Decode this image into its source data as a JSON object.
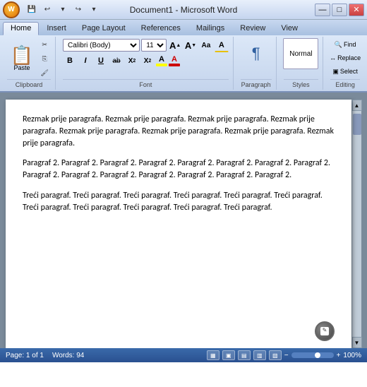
{
  "titlebar": {
    "title": "Document1 - Microsoft Word",
    "min_btn": "—",
    "max_btn": "□",
    "close_btn": "✕"
  },
  "quicktoolbar": {
    "save_icon": "💾",
    "undo_icon": "↩",
    "redo_icon": "↪"
  },
  "ribbon": {
    "tabs": [
      {
        "label": "Home",
        "active": true
      },
      {
        "label": "Insert",
        "active": false
      },
      {
        "label": "Page Layout",
        "active": false
      },
      {
        "label": "References",
        "active": false
      },
      {
        "label": "Mailings",
        "active": false
      },
      {
        "label": "Review",
        "active": false
      },
      {
        "label": "View",
        "active": false
      }
    ],
    "groups": {
      "clipboard": {
        "label": "Clipboard",
        "paste_label": "Paste"
      },
      "font": {
        "label": "Font",
        "font_name": "Calibri (Body)",
        "font_size": "11",
        "bold": "B",
        "italic": "I",
        "underline": "U",
        "strikethrough": "ab",
        "subscript": "X₂",
        "superscript": "X²",
        "clear": "A",
        "highlight_color": "#FFFF00",
        "font_color": "#FF0000",
        "grow_font": "A",
        "shrink_font": "A",
        "change_case": "Aa",
        "text_effects": "A"
      },
      "paragraph": {
        "label": "Paragraph"
      },
      "styles": {
        "label": "Styles",
        "normal_label": "Normal"
      },
      "editing": {
        "label": "Editing",
        "find_label": "Find",
        "replace_label": "Replace",
        "select_label": "Select"
      }
    }
  },
  "document": {
    "paragraphs": [
      "Rezmak prije paragrafa. Rezmak prije paragrafa. Rezmak prije paragrafa. Rezmak prije paragrafa. Rezmak prije paragrafa. Rezmak prije paragrafa. Rezmak prije paragrafa. Rezmak prije paragrafa.",
      "Paragraf 2. Paragraf 2. Paragraf 2. Paragraf 2. Paragraf 2. Paragraf 2. Paragraf 2. Paragraf 2. Paragraf 2. Paragraf 2. Paragraf 2. Paragraf 2. Paragraf 2. Paragraf 2. Paragraf 2.",
      "Treći paragraf. Treći paragraf. Treći paragraf. Treći paragraf. Treći paragraf. Treći paragraf. Treći paragraf. Treći paragraf. Treći paragraf. Treći paragraf. Treći paragraf."
    ]
  },
  "statusbar": {
    "page_info": "Page: 1 of 1",
    "word_count": "Words: 94",
    "zoom_level": "100%",
    "view_print": "▦",
    "view_full": "▣",
    "view_web": "▤",
    "view_outline": "▥",
    "view_draft": "▧"
  }
}
